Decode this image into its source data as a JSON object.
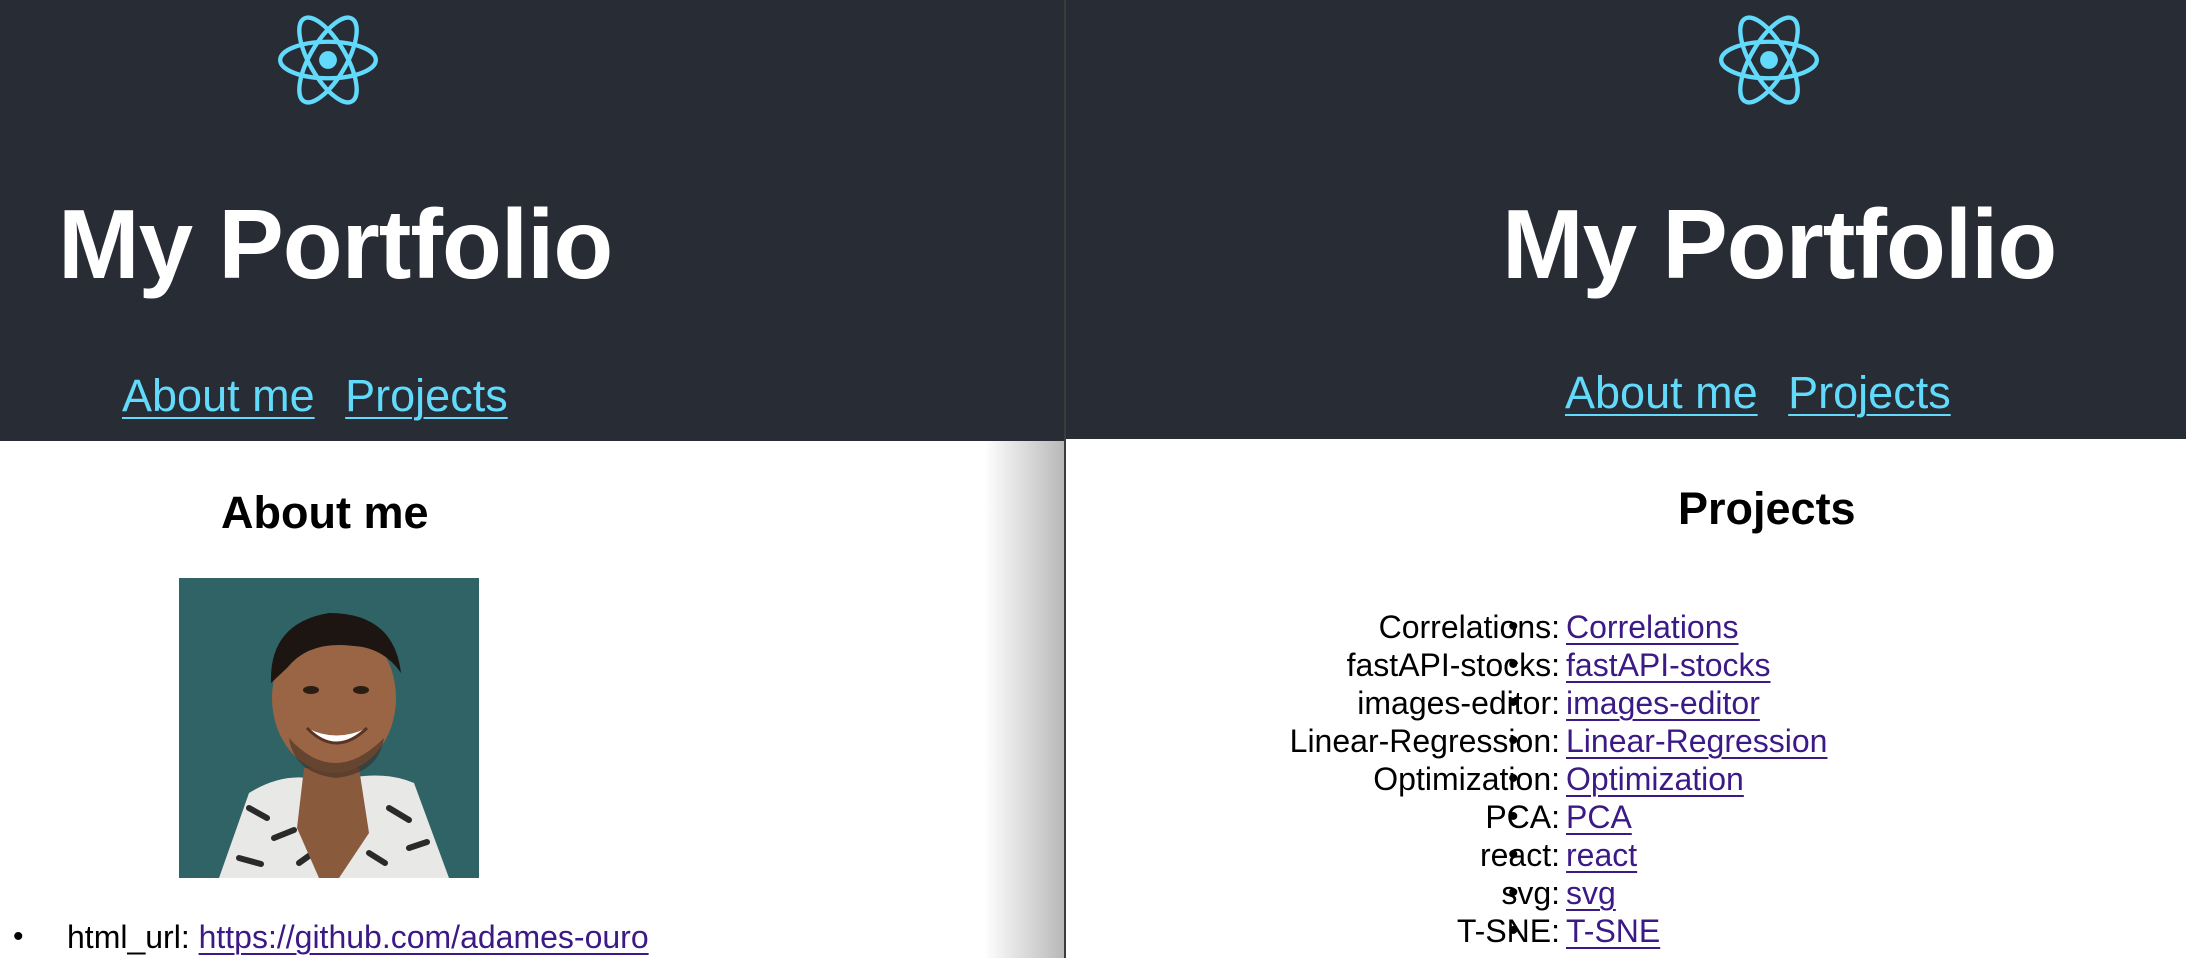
{
  "left_pane": {
    "header": {
      "logo_icon": "react-atom-icon",
      "title": "My Portfolio",
      "nav": [
        {
          "label": "About me"
        },
        {
          "label": "Projects"
        }
      ]
    },
    "main": {
      "heading": "About me",
      "profile_fields": [
        {
          "key": "html_url:",
          "value": "https://github.com/adames-ouro"
        }
      ]
    }
  },
  "right_pane": {
    "header": {
      "logo_icon": "react-atom-icon",
      "title": "My Portfolio",
      "nav": [
        {
          "label": "About me"
        },
        {
          "label": "Projects"
        }
      ]
    },
    "main": {
      "heading": "Projects",
      "projects": [
        {
          "name": "Correlations:",
          "link": "Correlations"
        },
        {
          "name": "fastAPI-stocks:",
          "link": "fastAPI-stocks"
        },
        {
          "name": "images-editor:",
          "link": "images-editor"
        },
        {
          "name": "Linear-Regression:",
          "link": "Linear-Regression"
        },
        {
          "name": "Optimization:",
          "link": "Optimization"
        },
        {
          "name": "PCA:",
          "link": "PCA"
        },
        {
          "name": "react:",
          "link": "react"
        },
        {
          "name": "svg:",
          "link": "svg"
        },
        {
          "name": "T-SNE:",
          "link": "T-SNE"
        }
      ]
    }
  },
  "colors": {
    "header_bg": "#282c34",
    "nav_link": "#61dafb",
    "content_link": "#3c1a86",
    "logo": "#61dafb"
  }
}
